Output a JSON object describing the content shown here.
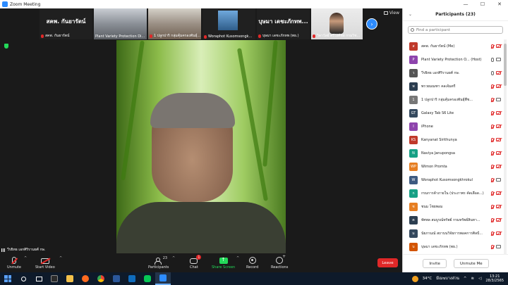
{
  "window": {
    "title": "Zoom Meeting"
  },
  "gallery": {
    "tiles": [
      {
        "name": "สคพ. กันยารัตน์",
        "big_name": "สคพ. กันยารัตน์",
        "muted": true
      },
      {
        "name": "Plant Variety Protection Di...",
        "muted": false
      },
      {
        "name": "1 ปลูกปาริ กลุ่มคุ้มครองพันธุ์...",
        "muted": true
      },
      {
        "name": "Woraphot Kusomsongk...",
        "muted": true
      },
      {
        "name": "บุษมา เดชะภักทพ (พธ.)",
        "big_name": "บุษมา เดชะภักทพ...",
        "muted": true
      },
      {
        "name": "วิลาวัลย์ ศรีวงศ์ชัย กรมวิช...",
        "muted": true
      }
    ],
    "view_label": "View"
  },
  "self_view": {
    "name": "วีรยิทธ เอกศิริรามยศ์ กษ."
  },
  "toolbar": {
    "unmute_label": "Unmute",
    "start_video_label": "Start Video",
    "participants_label": "Participants",
    "participants_count": "23",
    "chat_label": "Chat",
    "chat_badge": "1",
    "share_label": "Share Screen",
    "record_label": "Record",
    "reactions_label": "Reactions",
    "leave_label": "Leave"
  },
  "panel": {
    "title": "Participants (23)",
    "search_placeholder": "Find a participant",
    "invite_label": "Invite",
    "unmute_me_label": "Unmute Me",
    "participants": [
      {
        "initials": "ส",
        "color": "#c0392b",
        "name": "สคพ. กันยารัตน์ (Me)",
        "mic": "off",
        "cam": "off"
      },
      {
        "initials": "P",
        "color": "#8e44ad",
        "name": "Plant Variety Protection O... (Host)",
        "mic": "on",
        "cam": "on"
      },
      {
        "initials": "ว",
        "color": "#555555",
        "name": "วีรยิทธ เอกศิริรามยศ์ กษ.",
        "mic": "on",
        "cam": "off"
      },
      {
        "initials": "พ",
        "color": "#2c3e50",
        "name": "พรวยมณฑา คลเจ้มตรี",
        "mic": "off",
        "cam": "off"
      },
      {
        "initials": "1",
        "color": "#777777",
        "name": "1 ปลูกปาริ กลุ่มคุ้มครองพันธุ์พืช...",
        "mic": "off",
        "cam": "on"
      },
      {
        "initials": "GT",
        "color": "#34495e",
        "name": "Galaxy Tab S6 Lite",
        "mic": "off",
        "cam": "off"
      },
      {
        "initials": "I",
        "color": "#8e44ad",
        "name": "iPhone",
        "mic": "off",
        "cam": "off"
      },
      {
        "initials": "KS",
        "color": "#c0392b",
        "name": "Kanyanat Sirithunya",
        "mic": "off",
        "cam": "off"
      },
      {
        "initials": "N",
        "color": "#16a085",
        "name": "Naviya Janupongsa",
        "mic": "off",
        "cam": "off"
      },
      {
        "initials": "WP",
        "color": "#e67e22",
        "name": "Wimon Promta",
        "mic": "off",
        "cam": "off"
      },
      {
        "initials": "W",
        "color": "#3d5a80",
        "name": "Woraphot Kusomsongkhrokul",
        "mic": "off",
        "cam": "on"
      },
      {
        "initials": "ก",
        "color": "#16a085",
        "name": "กรมการค้าภายใน (ประภาพร คัดเลือด...)",
        "mic": "off",
        "cam": "off"
      },
      {
        "initials": "ช",
        "color": "#e67e22",
        "name": "ชนม โชยพอม",
        "mic": "off",
        "cam": "off"
      },
      {
        "initials": "ต",
        "color": "#2c3e50",
        "name": "ทัศพล สมบูรณ์ทรัพย์ กรมทรัพย์สินทา...",
        "mic": "off",
        "cam": "off"
      },
      {
        "initials": "ม",
        "color": "#34495e",
        "name": "นัยภามณ์ สถาบนวิจัยการพอคการศิลป์...",
        "mic": "off",
        "cam": "off"
      },
      {
        "initials": "บ",
        "color": "#d35400",
        "name": "บุษมา เดชะภักทพ (พธ.)",
        "mic": "off",
        "cam": "on"
      }
    ]
  },
  "taskbar": {
    "weather_temp": "34°C",
    "weather_text": "มีเมฆบางส่วน",
    "time": "13:21",
    "date": "28/3/2565"
  }
}
